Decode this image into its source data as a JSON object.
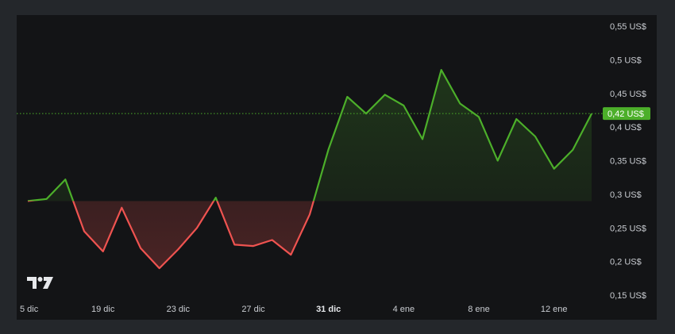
{
  "chart_data": {
    "type": "line",
    "baseline": 0.29,
    "last_value": 0.42,
    "last_value_label": "0,42 US$",
    "ylim": [
      0.15,
      0.56
    ],
    "y_ticks": [
      {
        "value": 0.55,
        "label": "0,55 US$"
      },
      {
        "value": 0.5,
        "label": "0,5 US$"
      },
      {
        "value": 0.45,
        "label": "0,45 US$"
      },
      {
        "value": 0.4,
        "label": "0,4 US$"
      },
      {
        "value": 0.35,
        "label": "0,35 US$"
      },
      {
        "value": 0.3,
        "label": "0,3 US$"
      },
      {
        "value": 0.25,
        "label": "0,25 US$"
      },
      {
        "value": 0.2,
        "label": "0,2 US$"
      },
      {
        "value": 0.15,
        "label": "0,15 US$"
      }
    ],
    "x_ticks": [
      {
        "label": "5 dic",
        "index": 0,
        "bold": false
      },
      {
        "label": "19 dic",
        "index": 4,
        "bold": false
      },
      {
        "label": "23 dic",
        "index": 8,
        "bold": false
      },
      {
        "label": "27 dic",
        "index": 12,
        "bold": false
      },
      {
        "label": "31 dic",
        "index": 16,
        "bold": true
      },
      {
        "label": "4 ene",
        "index": 20,
        "bold": false
      },
      {
        "label": "8 ene",
        "index": 24,
        "bold": false
      },
      {
        "label": "12 ene",
        "index": 28,
        "bold": false
      }
    ],
    "values": [
      0.29,
      0.293,
      0.322,
      0.245,
      0.215,
      0.28,
      0.22,
      0.19,
      0.218,
      0.25,
      0.295,
      0.225,
      0.223,
      0.232,
      0.21,
      0.27,
      0.367,
      0.445,
      0.42,
      0.448,
      0.432,
      0.382,
      0.485,
      0.435,
      0.415,
      0.35,
      0.412,
      0.386,
      0.338,
      0.366,
      0.42
    ],
    "colors": {
      "up": "#4caf2a",
      "down": "#ef5350",
      "price_tag": "#4caf2a",
      "last_price_line": "#4caf2a"
    }
  },
  "logo": {
    "text": "TV"
  }
}
